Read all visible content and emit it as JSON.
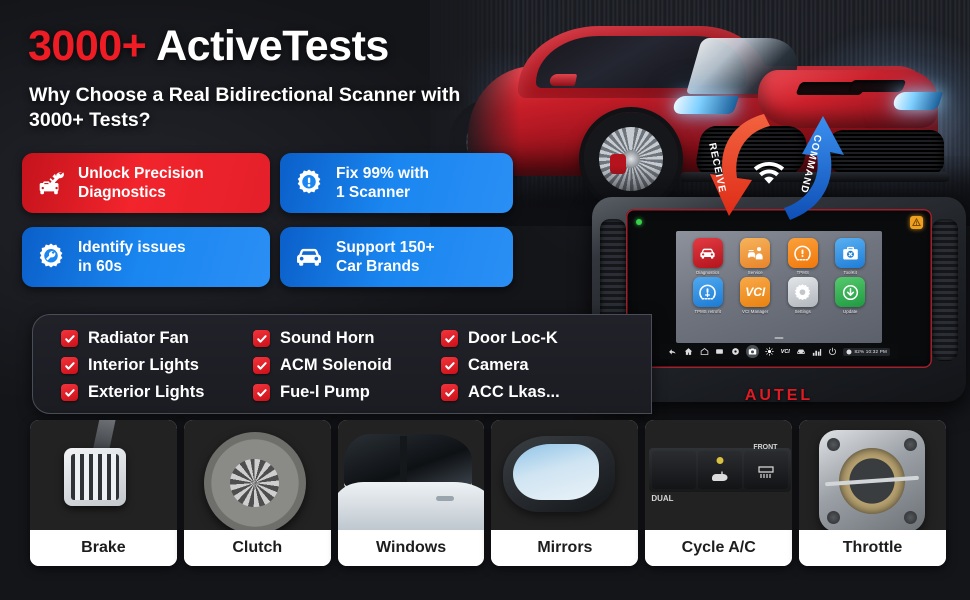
{
  "headline": {
    "number": "3000+",
    "rest": " ActiveTests",
    "subheading": "Why Choose a Real Bidirectional Scanner\nwith 3000+ Tests?"
  },
  "features": [
    {
      "icon": "car-repair-icon",
      "color": "#ee2029",
      "style": "red",
      "label": "Unlock Precision\nDiagnostics"
    },
    {
      "icon": "gear-alert-icon",
      "color": "#1a86f0",
      "style": "blue",
      "label": "Fix 99% with\n1 Scanner"
    },
    {
      "icon": "gear-wrench-icon",
      "color": "#1a86f0",
      "style": "blue",
      "label": "Identify issues\nin 60s"
    },
    {
      "icon": "car-icon",
      "color": "#1a86f0",
      "style": "blue",
      "label": "Support 150+\nCar Brands"
    }
  ],
  "checklist": {
    "check_color": "#e4141e",
    "items": [
      "Radiator Fan",
      "Sound Horn",
      "Door Loc-K",
      "Interior Lights",
      "ACM Solenoid",
      "Camera",
      "Exterior Lights",
      "Fue-l Pump",
      "ACC Lkas..."
    ]
  },
  "arrows": {
    "receive": {
      "label": "RECEIVE",
      "color": "#e8402c"
    },
    "command": {
      "label": "COMMAND",
      "color": "#1668d8"
    },
    "signal_icon": "wifi-icon"
  },
  "device": {
    "brand": "AUTEL",
    "status_led": "power-led-icon",
    "warning_led": "warning-icon",
    "apps": [
      {
        "name": "Diagnostics",
        "icon": "car-icon",
        "color": "#d7232c"
      },
      {
        "name": "Service",
        "icon": "service-icon",
        "color": "#f2a03c"
      },
      {
        "name": "TPMS",
        "icon": "tire-pressure-icon",
        "color": "#f68a1e"
      },
      {
        "name": "ToolKit",
        "icon": "toolbox-icon",
        "color": "#2f96e8"
      },
      {
        "name": "TPMS retrofit",
        "icon": "tire-pressure-icon",
        "color": "#2f96e8"
      },
      {
        "name": "VCI Manager",
        "icon": "vci-icon",
        "color": "#f2922e"
      },
      {
        "name": "Settings",
        "icon": "gear-icon",
        "color": "#c9ccd1"
      },
      {
        "name": "Update",
        "icon": "download-icon",
        "color": "#35b254"
      }
    ],
    "taskbar_icons": [
      "back-icon",
      "home-icon",
      "house-icon",
      "apps-icon",
      "location-icon",
      "camera-icon",
      "brightness-icon",
      "vci-icon",
      "car-icon",
      "data-icon",
      "power-icon"
    ],
    "status_text": "82%  10:32 PM"
  },
  "thumbnails": [
    {
      "label": "Brake",
      "image": "brake-pedal-photo"
    },
    {
      "label": "Clutch",
      "image": "clutch-disc-photo"
    },
    {
      "label": "Windows",
      "image": "car-windows-photo"
    },
    {
      "label": "Mirrors",
      "image": "side-mirror-photo"
    },
    {
      "label": "Cycle A/C",
      "image": "ac-buttons-photo"
    },
    {
      "label": "Throttle",
      "image": "throttle-body-photo"
    }
  ],
  "ac_photo_labels": {
    "dual": "DUAL",
    "front": "FRONT"
  }
}
